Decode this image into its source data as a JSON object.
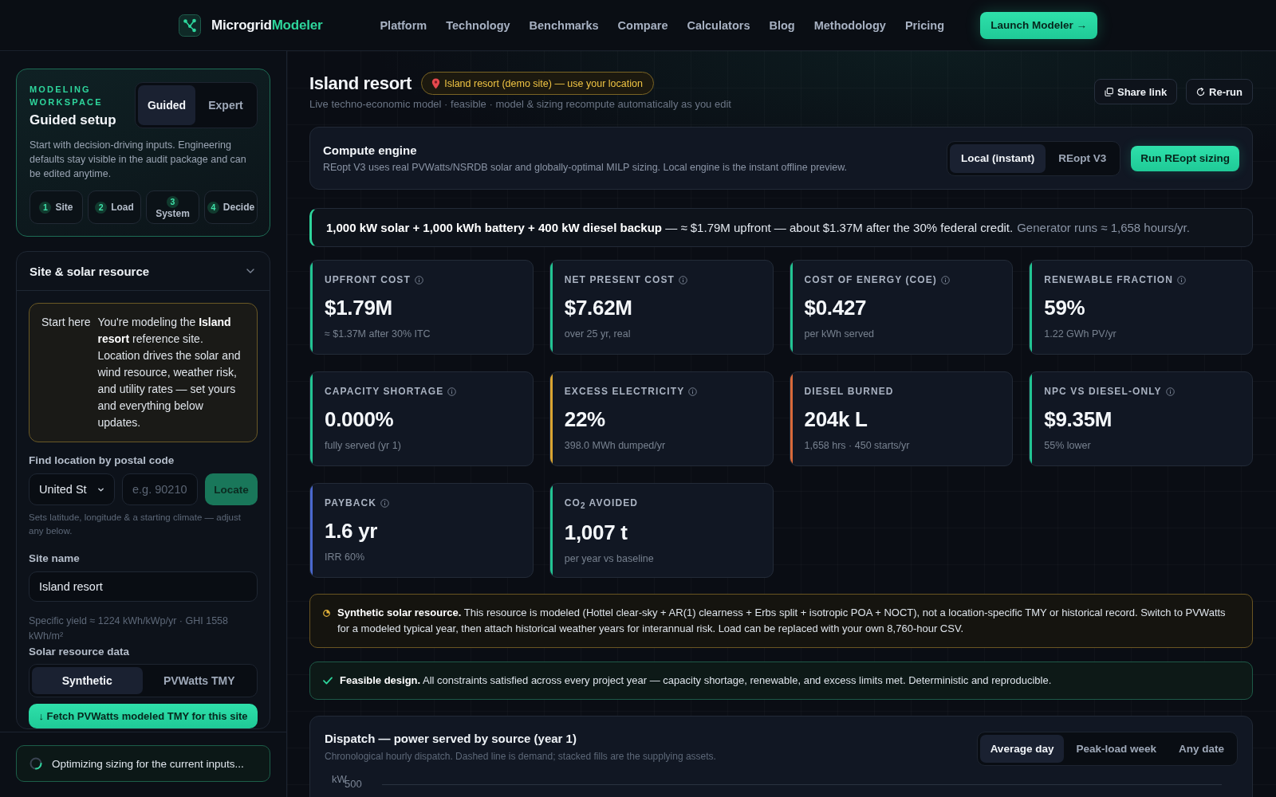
{
  "nav": {
    "brand": {
      "name": "Microgrid",
      "accent": "Modeler"
    },
    "links": [
      "Platform",
      "Technology",
      "Benchmarks",
      "Compare",
      "Calculators",
      "Blog",
      "Methodology",
      "Pricing"
    ],
    "cta": "Launch Modeler →"
  },
  "sidebar": {
    "workspace": {
      "eyebrow": "MODELING WORKSPACE",
      "title": "Guided setup",
      "modes": [
        {
          "label": "Guided",
          "selected": true
        },
        {
          "label": "Expert",
          "selected": false
        }
      ],
      "description": "Start with decision-driving inputs. Engineering defaults stay visible in the audit package and can be edited anytime.",
      "steps": [
        {
          "number": "1",
          "label": "Site"
        },
        {
          "number": "2",
          "label": "Load"
        },
        {
          "number": "3",
          "label": "System"
        },
        {
          "number": "4",
          "label": "Decide"
        }
      ]
    },
    "section": {
      "title": "Site & solar resource",
      "expanded": true,
      "notice": {
        "label": "Start here",
        "text": "You're modeling the **Island resort** reference site. Location drives the solar and wind resource, weather risk, and utility rates — set yours and everything below updates."
      },
      "postal": {
        "label": "Find location by postal code",
        "country": "United St",
        "code": {
          "placeholder": "e.g. 90210"
        },
        "button": {
          "label": "Locate",
          "disabled": true
        },
        "help": "Sets latitude, longitude & a starting climate — adjust any below."
      },
      "site_name": {
        "label": "Site name",
        "value": "Island resort"
      },
      "yield_note": "Specific yield ≈ 1224 kWh/kWp/yr · GHI 1558 kWh/m²",
      "resource": {
        "label": "Solar resource data",
        "options": [
          {
            "label": "Synthetic",
            "selected": true
          },
          {
            "label": "PVWatts TMY",
            "selected": false
          }
        ],
        "fetch_button": "↓ Fetch PVWatts modeled TMY for this site"
      }
    },
    "status": "Optimizing sizing for the current inputs..."
  },
  "main": {
    "header": {
      "title": "Island resort",
      "location_badge": "Island resort (demo site) — use your location",
      "subtitle": "Live techno-economic model · feasible · model & sizing recompute automatically as you edit",
      "actions": [
        {
          "label": "Share link",
          "kind": "share"
        },
        {
          "label": "Re-run",
          "kind": "rerun"
        }
      ]
    },
    "engine": {
      "title": "Compute engine",
      "description": "REopt V3 uses real PVWatts/NSRDB solar and globally-optimal MILP sizing. Local engine is the instant offline preview.",
      "options": [
        {
          "label": "Local (instant)",
          "selected": true
        },
        {
          "label": "REopt V3",
          "selected": false
        }
      ],
      "run_button": "Run REopt sizing"
    },
    "summary": {
      "text": "**1,000 kW solar + 1,000 kWh battery + 400 kW diesel backup** — ≈ $1.79M upfront — about $1.37M after the 30% federal credit.",
      "note": "Generator runs ≈ 1,658 hours/yr."
    },
    "kpis": [
      {
        "label": "UPFRONT COST",
        "info": true,
        "value": "$1.79M",
        "sub": "≈ $1.37M after 30% ITC",
        "color": "#22c493"
      },
      {
        "label": "NET PRESENT COST",
        "info": true,
        "value": "$7.62M",
        "sub": "over 25 yr, real",
        "color": "#22c493"
      },
      {
        "label": "COST OF ENERGY (COE)",
        "info": true,
        "value": "$0.427",
        "sub": "per kWh served",
        "color": "#22c493"
      },
      {
        "label": "RENEWABLE FRACTION",
        "info": true,
        "value": "59%",
        "sub": "1.22 GWh PV/yr",
        "color": "#22c493"
      },
      {
        "label": "CAPACITY SHORTAGE",
        "info": true,
        "value": "0.000%",
        "sub": "fully served (yr 1)",
        "color": "#22c493"
      },
      {
        "label": "EXCESS ELECTRICITY",
        "info": true,
        "value": "22%",
        "sub": "398.0 MWh dumped/yr",
        "color": "#d9a431"
      },
      {
        "label": "DIESEL BURNED",
        "info": false,
        "value": "204k L",
        "sub": "1,658 hrs · 450 starts/yr",
        "color": "#d8693a"
      },
      {
        "label": "NPC VS DIESEL-ONLY",
        "info": true,
        "value": "$9.35M",
        "sub": "55% lower",
        "color": "#22c493"
      },
      {
        "label": "PAYBACK",
        "info": true,
        "value": "1.6 yr",
        "sub": "IRR 60%",
        "color": "#4a68cf"
      },
      {
        "label": "CO$_{2}$ AVOIDED",
        "info": false,
        "value": "1,007 t",
        "sub": "per year vs baseline",
        "color": "#22c493"
      }
    ],
    "alerts": [
      {
        "kind": "warning",
        "text": "**Synthetic solar resource.** This resource is modeled (Hottel clear-sky + AR(1) clearness + Erbs split + isotropic POA + NOCT), not a location-specific TMY or historical record. Switch to PVWatts for a modeled typical year, then attach historical weather years for interannual risk. Load can be replaced with your own 8,760-hour CSV."
      },
      {
        "kind": "success",
        "text": "**Feasible design.** All constraints satisfied across every project year — capacity shortage, renewable, and excess limits met. Deterministic and reproducible."
      }
    ],
    "dispatch": {
      "title": "Dispatch — power served by source (year 1)",
      "subtitle": "Chronological hourly dispatch. Dashed line is demand; stacked fills are the supplying assets.",
      "views": [
        {
          "label": "Average day",
          "selected": true
        },
        {
          "label": "Peak-load week",
          "selected": false
        },
        {
          "label": "Any date",
          "selected": false
        }
      ],
      "y_unit": "kW",
      "y_tick": "500"
    }
  }
}
